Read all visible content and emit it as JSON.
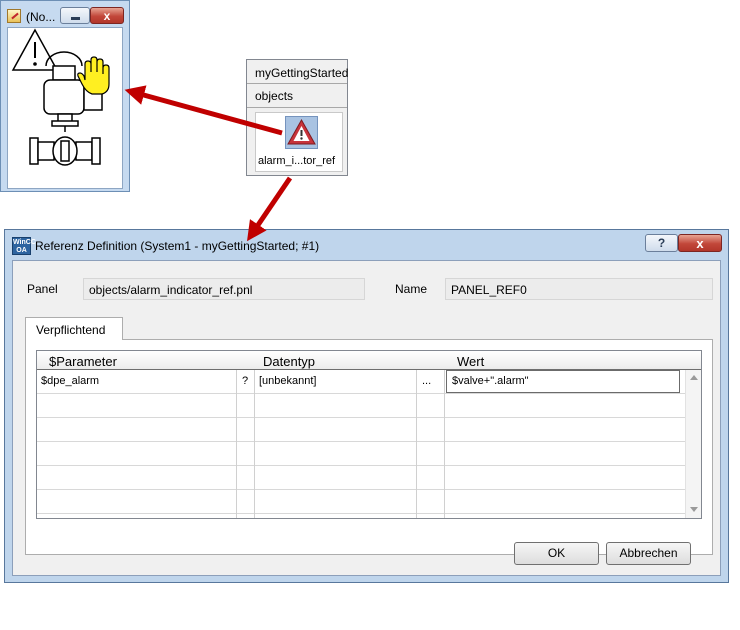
{
  "preview_window": {
    "title": "(No...",
    "minimize_glyph": "–",
    "close_glyph": "x",
    "icons": [
      "edit-panel-icon",
      "warning-triangle-icon",
      "hand-cursor-icon",
      "valve-icon"
    ]
  },
  "library": {
    "title": "myGettingStarted",
    "category": "objects",
    "item_label": "alarm_i...tor_ref",
    "item_icon": "warning-triangle-icon"
  },
  "dialog": {
    "title": "Referenz Definition (System1 - myGettingStarted; #1)",
    "app_icon_text": "WinCC OA",
    "help_glyph": "?",
    "close_glyph": "x",
    "panel_label": "Panel",
    "panel_value": "objects/alarm_indicator_ref.pnl",
    "name_label": "Name",
    "name_value": "PANEL_REF0",
    "tab_label": "Verpflichtend",
    "table": {
      "headers": [
        "$Parameter",
        "Datentyp",
        "Wert"
      ],
      "rows": [
        {
          "parameter": "$dpe_alarm",
          "flag": "?",
          "datatype": "[unbekannt]",
          "more": "...",
          "value": "$valve+\".alarm\""
        }
      ]
    },
    "ok_label": "OK",
    "cancel_label": "Abbrechen"
  },
  "colors": {
    "arrow": "#c00000",
    "window_frame": "#bfd5ec",
    "close_button": "#c2473a"
  }
}
